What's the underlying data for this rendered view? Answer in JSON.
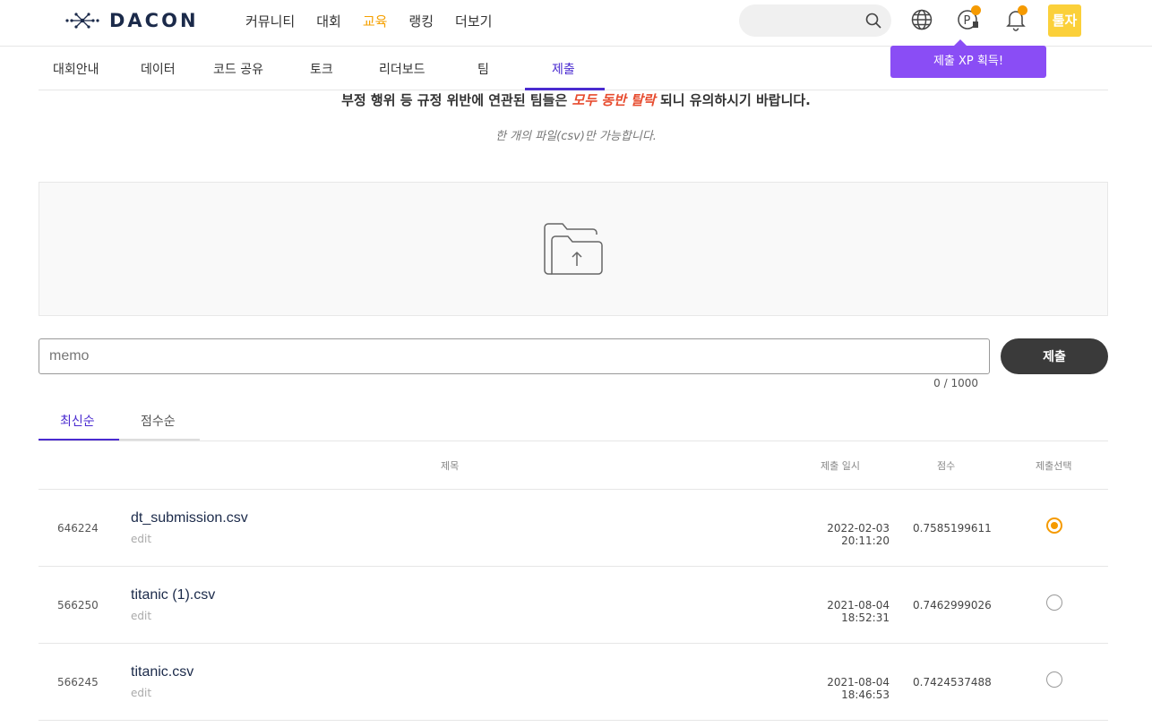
{
  "header": {
    "logo": "DACON",
    "nav": [
      "커뮤니티",
      "대회",
      "교육",
      "랭킹",
      "더보기"
    ],
    "avatar_text": "툴자",
    "tooltip": "제출 XP 획득!"
  },
  "tabs": [
    "대회안내",
    "데이터",
    "코드 공유",
    "토크",
    "리더보드",
    "팀",
    "제출"
  ],
  "notice": {
    "before": "부정 행위 등 규정 위반에 연관된 팀들은 ",
    "warn": "모두 동반 탈락",
    "after": " 되니 유의하시기 바랍니다.",
    "sub": "한 개의 파일(csv)만 가능합니다."
  },
  "memo": {
    "placeholder": "memo",
    "submit_label": "제출",
    "counter": "0 / 1000"
  },
  "sort_tabs": [
    "최신순",
    "점수순"
  ],
  "table": {
    "headers": {
      "title": "제목",
      "date": "제출 일시",
      "score": "점수",
      "select": "제출선택"
    },
    "edit_label": "edit",
    "rows": [
      {
        "id": "646224",
        "file": "dt_submission.csv",
        "date": "2022-02-03 20:11:20",
        "score": "0.7585199611",
        "selected": true
      },
      {
        "id": "566250",
        "file": "titanic (1).csv",
        "date": "2021-08-04 18:52:31",
        "score": "0.7462999026",
        "selected": false
      },
      {
        "id": "566245",
        "file": "titanic.csv",
        "date": "2021-08-04 18:46:53",
        "score": "0.7424537488",
        "selected": false
      }
    ]
  },
  "colors": {
    "accent": "#4a2bd0",
    "orange": "#f59a00",
    "warn": "#e74c2f",
    "tooltip": "#8a4df5"
  }
}
